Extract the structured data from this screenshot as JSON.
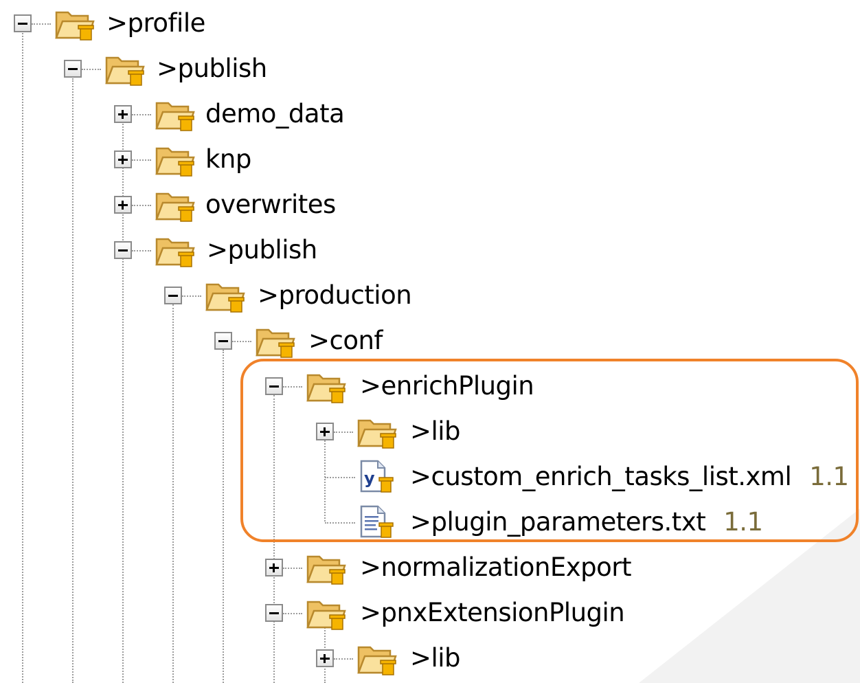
{
  "colors": {
    "highlight": "#f0822a",
    "folder_body": "#f5d27a",
    "folder_edge": "#b8892d",
    "badge": "#f6b400",
    "version_text": "#7a6c3a"
  },
  "tree": {
    "nodes": [
      {
        "label": ">profile",
        "toggle": "minus",
        "icon": "folder-icon"
      },
      {
        "label": ">publish",
        "toggle": "minus",
        "icon": "folder-icon"
      },
      {
        "label": "demo_data",
        "toggle": "plus",
        "icon": "folder-icon"
      },
      {
        "label": "knp",
        "toggle": "plus",
        "icon": "folder-icon"
      },
      {
        "label": "overwrites",
        "toggle": "plus",
        "icon": "folder-icon"
      },
      {
        "label": ">publish",
        "toggle": "minus",
        "icon": "folder-icon"
      },
      {
        "label": ">production",
        "toggle": "minus",
        "icon": "folder-icon"
      },
      {
        "label": ">conf",
        "toggle": "minus",
        "icon": "folder-icon"
      },
      {
        "label": ">enrichPlugin",
        "toggle": "minus",
        "icon": "folder-icon"
      },
      {
        "label": ">lib",
        "toggle": "plus",
        "icon": "folder-icon"
      },
      {
        "label": ">custom_enrich_tasks_list.xml",
        "version": "1.1",
        "icon": "xml-file-icon"
      },
      {
        "label": ">plugin_parameters.txt",
        "version": "1.1",
        "icon": "text-file-icon"
      },
      {
        "label": ">normalizationExport",
        "toggle": "plus",
        "icon": "folder-icon"
      },
      {
        "label": ">pnxExtensionPlugin",
        "toggle": "minus",
        "icon": "folder-icon"
      },
      {
        "label": ">lib",
        "toggle": "plus",
        "icon": "folder-icon"
      }
    ]
  }
}
